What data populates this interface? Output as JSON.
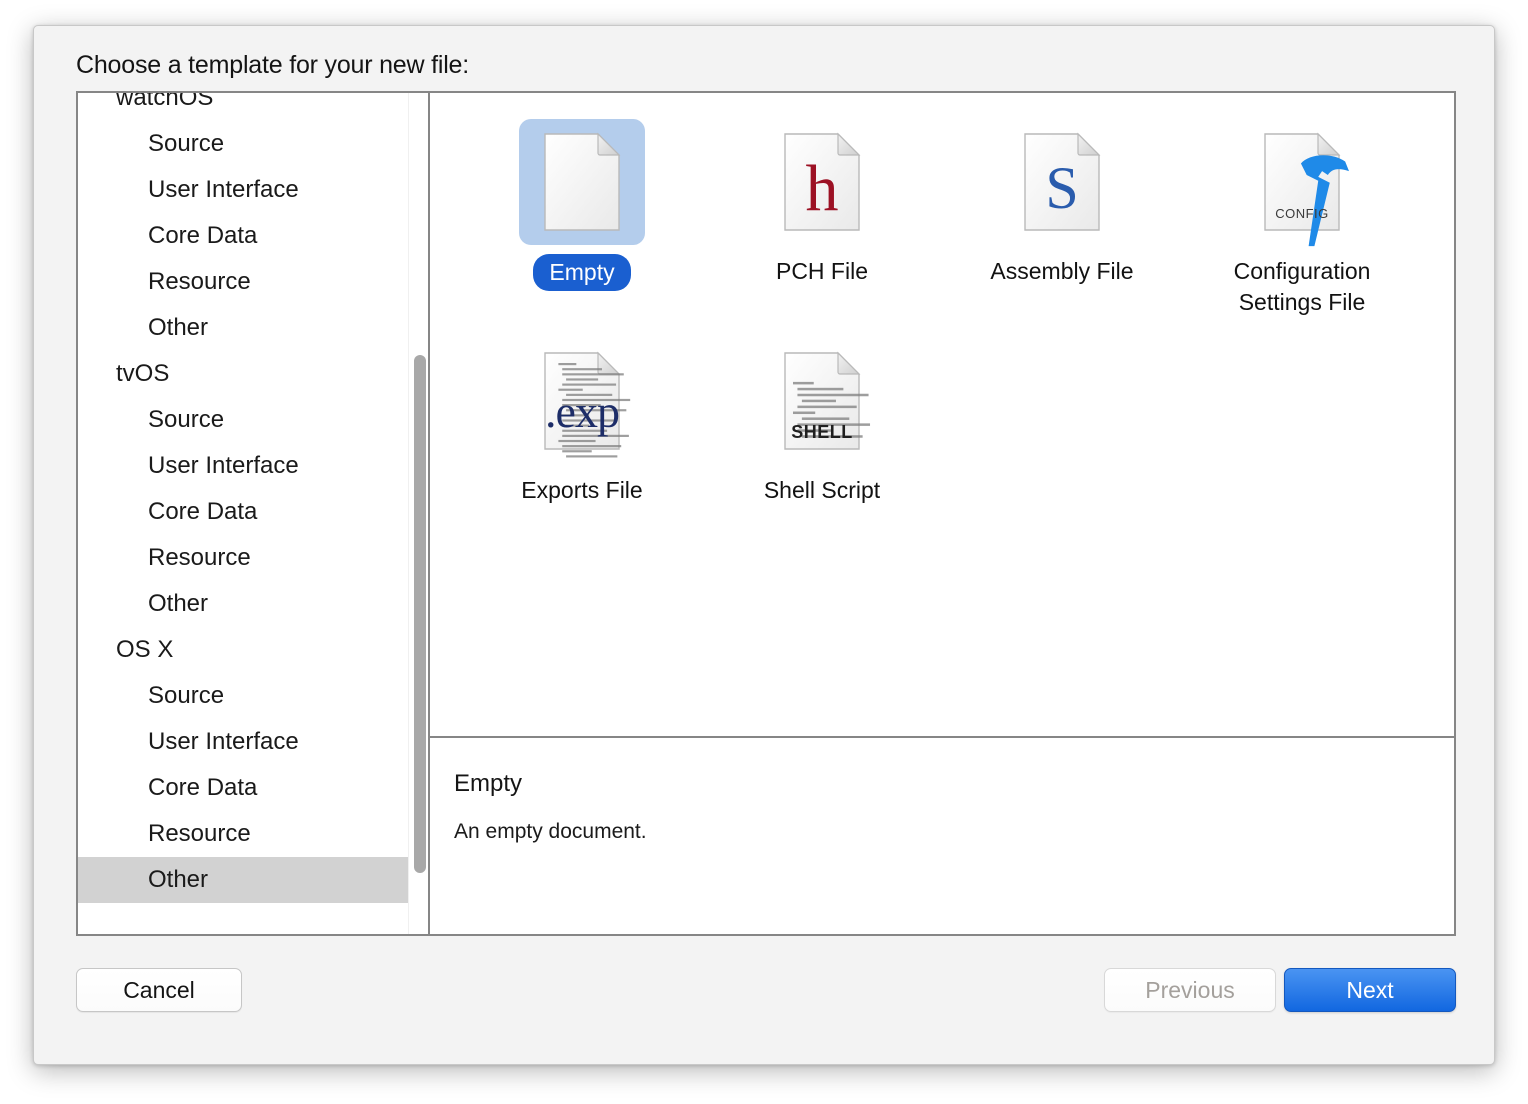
{
  "dialog": {
    "title": "Choose a template for your new file:"
  },
  "sidebar": {
    "items": [
      {
        "label": "watchOS",
        "level": "group",
        "selected": false
      },
      {
        "label": "Source",
        "level": "child",
        "selected": false
      },
      {
        "label": "User Interface",
        "level": "child",
        "selected": false
      },
      {
        "label": "Core Data",
        "level": "child",
        "selected": false
      },
      {
        "label": "Resource",
        "level": "child",
        "selected": false
      },
      {
        "label": "Other",
        "level": "child",
        "selected": false
      },
      {
        "label": "tvOS",
        "level": "group",
        "selected": false
      },
      {
        "label": "Source",
        "level": "child",
        "selected": false
      },
      {
        "label": "User Interface",
        "level": "child",
        "selected": false
      },
      {
        "label": "Core Data",
        "level": "child",
        "selected": false
      },
      {
        "label": "Resource",
        "level": "child",
        "selected": false
      },
      {
        "label": "Other",
        "level": "child",
        "selected": false
      },
      {
        "label": "OS X",
        "level": "group",
        "selected": false
      },
      {
        "label": "Source",
        "level": "child",
        "selected": false
      },
      {
        "label": "User Interface",
        "level": "child",
        "selected": false
      },
      {
        "label": "Core Data",
        "level": "child",
        "selected": false
      },
      {
        "label": "Resource",
        "level": "child",
        "selected": false
      },
      {
        "label": "Other",
        "level": "child",
        "selected": true
      }
    ],
    "scrollbar": {
      "name": "vertical-scrollbar"
    }
  },
  "templates": [
    {
      "label": "Empty",
      "icon": "empty-document-icon",
      "selected": true
    },
    {
      "label": "PCH File",
      "icon": "pch-file-icon",
      "selected": false,
      "glyph": "h"
    },
    {
      "label": "Assembly File",
      "icon": "assembly-file-icon",
      "selected": false,
      "glyph": "S"
    },
    {
      "label": "Configuration Settings File",
      "icon": "config-settings-icon",
      "selected": false,
      "glyph": "CONFIG"
    },
    {
      "label": "Exports File",
      "icon": "exports-file-icon",
      "selected": false,
      "glyph": ".exp"
    },
    {
      "label": "Shell Script",
      "icon": "shell-script-icon",
      "selected": false,
      "glyph": "SHELL"
    }
  ],
  "description": {
    "title": "Empty",
    "body": "An empty document."
  },
  "footer": {
    "cancel_label": "Cancel",
    "previous_label": "Previous",
    "next_label": "Next"
  },
  "colors": {
    "selection_icon_bg": "#b4cdec",
    "selection_label_bg": "#1a5fd0",
    "sidebar_selection_bg": "#d2d2d2",
    "default_button_blue": "#1267e0",
    "pch_glyph": "#9c1124",
    "assembly_glyph": "#2a5cad",
    "config_hammer": "#1f8ae8",
    "exports_glyph": "#1d2d68"
  }
}
